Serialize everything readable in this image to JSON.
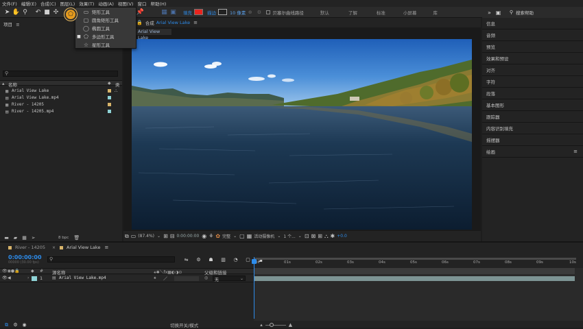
{
  "menu": [
    "文件(F)",
    "编辑(E)",
    "合成(C)",
    "图层(L)",
    "效果(T)",
    "动画(A)",
    "视图(V)",
    "窗口",
    "帮助(H)"
  ],
  "toolbar": {
    "fill_label": "填充",
    "stroke_label": "描边",
    "stroke_width": "10 像素",
    "bezier_label": "贝塞尔曲线路径",
    "workspaces": [
      "默认",
      "了解",
      "标准",
      "小屏幕",
      "库"
    ],
    "search_help": "搜索帮助",
    "colors": {
      "fill": "#e8251f",
      "stroke": "#222222",
      "accent": "#2d8ceb",
      "shape_tool": "#e59b1e"
    }
  },
  "shape_menu": {
    "items": [
      {
        "label": "矩形工具",
        "icon": "rectangle-icon",
        "selected": false
      },
      {
        "label": "圆角矩形工具",
        "icon": "rounded-rectangle-icon",
        "selected": false
      },
      {
        "label": "椭圆工具",
        "icon": "ellipse-icon",
        "selected": false
      },
      {
        "label": "多边形工具",
        "icon": "polygon-icon",
        "selected": true
      },
      {
        "label": "星形工具",
        "icon": "star-icon",
        "selected": false
      }
    ]
  },
  "project": {
    "title": "项目",
    "menu_glyph": "≡",
    "header_name": "名称",
    "header_type": "类",
    "items": [
      {
        "name": "Arial View Lake",
        "type": "composition",
        "color": "#d8b46a"
      },
      {
        "name": "Arial View Lake.mp4",
        "type": "footage",
        "color": "#8fd3d6"
      },
      {
        "name": "River - 14205",
        "type": "composition",
        "color": "#d8b46a"
      },
      {
        "name": "River - 14205.mp4",
        "type": "footage",
        "color": "#8fd3d6"
      }
    ],
    "bpc": "8 bpc"
  },
  "composition": {
    "tab_prefix": "合成",
    "tab_name": "Arial View Lake",
    "subtab": "Arial View Lake",
    "zoom": "(87.4%)",
    "timecode": "0:00:00:00",
    "resolution": "完整",
    "camera": "活动摄像机",
    "views": "1 个...",
    "exposure": "+0.0"
  },
  "right_panel": {
    "items": [
      "信息",
      "音频",
      "预览",
      "效果和预设",
      "对齐",
      "字符",
      "段落",
      "基本图形",
      "跟踪器",
      "内容识别填充",
      "摇摆器",
      "绘画"
    ]
  },
  "timeline": {
    "tabs": [
      {
        "label": "River - 14205",
        "color": "#d8b46a",
        "active": false
      },
      {
        "label": "Arial View Lake",
        "color": "#d8b46a",
        "active": true
      }
    ],
    "timecode": "0:00:00:00",
    "frame_info": "00000 (30.00 fps)",
    "col_source": "源名称",
    "col_parent": "父级和链接",
    "layer": {
      "index": "1",
      "name": "Arial View Lake.mp4",
      "parent": "无",
      "color": "#8fd3d6"
    },
    "ruler": [
      "0s",
      "01s",
      "02s",
      "03s",
      "04s",
      "05s",
      "06s",
      "07s",
      "08s",
      "09s",
      "10s"
    ],
    "toggle_label": "切换开关/模式"
  }
}
